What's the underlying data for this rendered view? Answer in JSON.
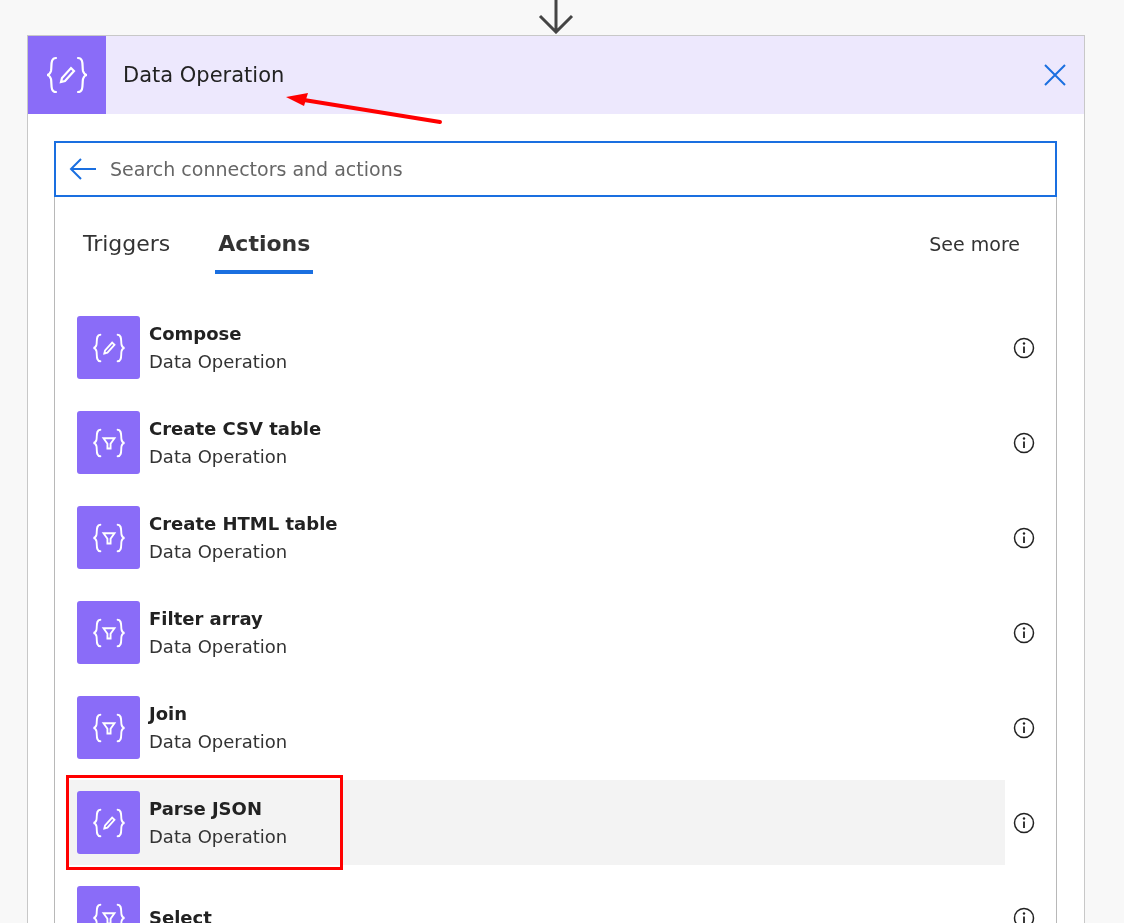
{
  "header": {
    "title": "Data Operation"
  },
  "search": {
    "placeholder": "Search connectors and actions"
  },
  "tabs": [
    {
      "label": "Triggers",
      "selected": false
    },
    {
      "label": "Actions",
      "selected": true
    }
  ],
  "see_more": "See more",
  "actions": [
    {
      "name": "Compose",
      "connector": "Data Operation",
      "kind": "pencil",
      "selected": false,
      "annotated": false
    },
    {
      "name": "Create CSV table",
      "connector": "Data Operation",
      "kind": "filter",
      "selected": false,
      "annotated": false
    },
    {
      "name": "Create HTML table",
      "connector": "Data Operation",
      "kind": "filter",
      "selected": false,
      "annotated": false
    },
    {
      "name": "Filter array",
      "connector": "Data Operation",
      "kind": "filter",
      "selected": false,
      "annotated": false
    },
    {
      "name": "Join",
      "connector": "Data Operation",
      "kind": "filter",
      "selected": false,
      "annotated": false
    },
    {
      "name": "Parse JSON",
      "connector": "Data Operation",
      "kind": "pencil",
      "selected": true,
      "annotated": true
    },
    {
      "name": "Select",
      "kind": "filter",
      "selected": false,
      "annotated": false
    }
  ]
}
